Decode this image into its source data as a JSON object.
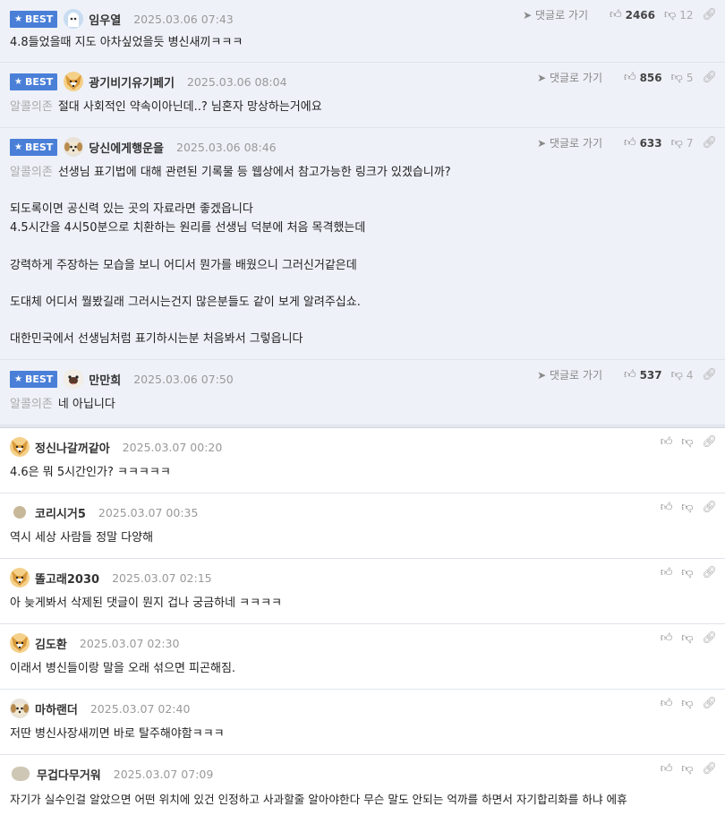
{
  "best_label": "BEST",
  "reply_label": "댓글로 가기",
  "best": [
    {
      "nick": "임우열",
      "date": "2025.03.06 07:43",
      "likes": "2466",
      "dislikes": "12",
      "prefix": "",
      "text": "4.8들었을때 지도 아차싶었을듯 병신새끼ㅋㅋㅋ",
      "avatar": "ghost"
    },
    {
      "nick": "광기비기유기페기",
      "date": "2025.03.06 08:04",
      "likes": "856",
      "dislikes": "5",
      "prefix": "알콜의존",
      "text": "절대 사회적인 약속이아닌데..? 님혼자 망상하는거에요",
      "avatar": "fox"
    },
    {
      "nick": "당신에게행운을",
      "date": "2025.03.06 08:46",
      "likes": "633",
      "dislikes": "7",
      "prefix": "알콜의존",
      "text": "선생님 표기법에 대해 관련된 기록물 등 웹상에서 참고가능한 링크가 있겠습니까?\n\n되도록이면 공신력 있는 곳의 자료라면 좋겠읍니다\n4.5시간을 4시50분으로 치환하는 원리를 선생님 덕분에 처음 목격했는데\n\n강력하게 주장하는 모습을 보니 어디서 뭔가를 배웠으니 그러신거같은데\n\n도대체 어디서 뭘봤길래 그러시는건지 많은분들도 같이 보게 알려주십쇼.\n\n대한민국에서 선생님처럼 표기하시는분 처음봐서 그렇읍니다",
      "avatar": "pup"
    },
    {
      "nick": "만만희",
      "date": "2025.03.06 07:50",
      "likes": "537",
      "dislikes": "4",
      "prefix": "알콜의존",
      "text": "네 아닙니다",
      "avatar": "pug"
    }
  ],
  "comments": [
    {
      "nick": "정신나갈꺼같아",
      "date": "2025.03.07 00:20",
      "text": "4.6은 뭐 5시간인가? ㅋㅋㅋㅋㅋ",
      "avatar": "fox"
    },
    {
      "nick": "코리시거5",
      "date": "2025.03.07 00:35",
      "text": "역시 세상 사람들 정말 다양해",
      "avatar": "dot"
    },
    {
      "nick": "똘고래2030",
      "date": "2025.03.07 02:15",
      "text": "아 늦게봐서 삭제된 댓글이 뭔지 겁나 궁금하네 ㅋㅋㅋㅋ",
      "avatar": "fox"
    },
    {
      "nick": "김도환",
      "date": "2025.03.07 02:30",
      "text": "이래서 병신들이랑 말을 오래 섞으면 피곤해짐.",
      "avatar": "fox"
    },
    {
      "nick": "마하랜더",
      "date": "2025.03.07 02:40",
      "text": "저딴 병신사장새끼면 바로 탈주해야함ㅋㅋㅋ",
      "avatar": "pup"
    },
    {
      "nick": "무겁다무거워",
      "date": "2025.03.07 07:09",
      "text": "자기가 실수인걸 알았으면 어떤 위치에 있건 인정하고 사과할줄 알아야한다 무슨 말도 안되는 억까를 하면서 자기합리화를 하냐 에휴",
      "avatar": "blob"
    }
  ]
}
